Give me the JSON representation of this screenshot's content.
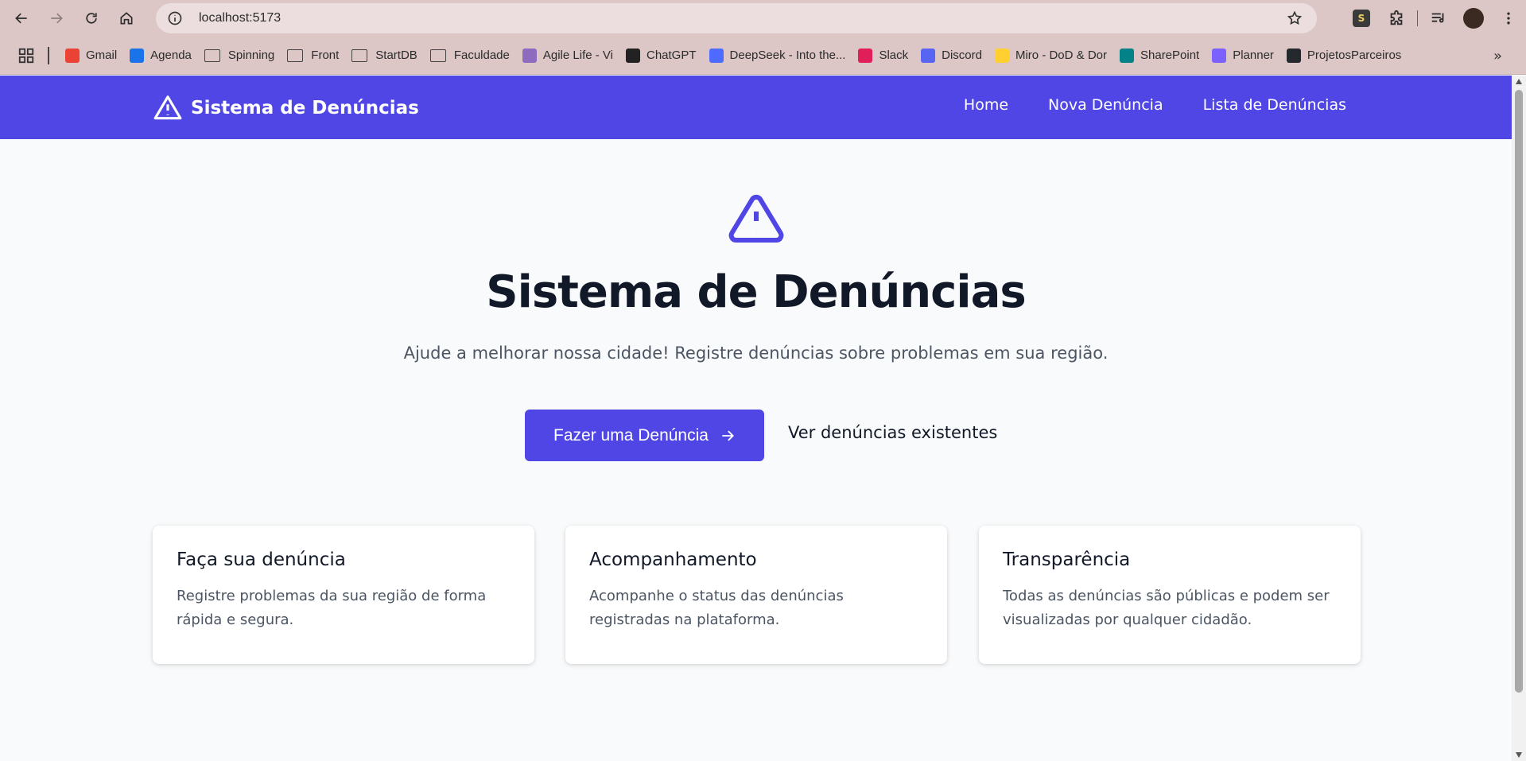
{
  "browser": {
    "url": "localhost:5173",
    "bookmarks": [
      {
        "label": "Gmail",
        "icon": "gmail-icon",
        "color": "#ea4335"
      },
      {
        "label": "Agenda",
        "icon": "calendar-icon",
        "color": "#1a73e8"
      },
      {
        "label": "Spinning",
        "icon": "folder-icon"
      },
      {
        "label": "Front",
        "icon": "folder-icon"
      },
      {
        "label": "StartDB",
        "icon": "folder-icon"
      },
      {
        "label": "Faculdade",
        "icon": "folder-icon"
      },
      {
        "label": "Agile Life - Vi",
        "icon": "avatar-icon",
        "color": "#8e6bbf"
      },
      {
        "label": "ChatGPT",
        "icon": "chatgpt-icon",
        "color": "#222222"
      },
      {
        "label": "DeepSeek - Into the...",
        "icon": "deepseek-icon",
        "color": "#4d6bfe"
      },
      {
        "label": "Slack",
        "icon": "slack-icon",
        "color": "#e01e5a"
      },
      {
        "label": "Discord",
        "icon": "discord-icon",
        "color": "#5865f2"
      },
      {
        "label": "Miro - DoD & Dor",
        "icon": "miro-icon",
        "color": "#ffd02f"
      },
      {
        "label": "SharePoint",
        "icon": "sharepoint-icon",
        "color": "#038387"
      },
      {
        "label": "Planner",
        "icon": "planner-icon",
        "color": "#7b61ff"
      },
      {
        "label": "ProjetosParceiros",
        "icon": "github-icon",
        "color": "#24292e"
      }
    ]
  },
  "navbar": {
    "brand": "Sistema de Denúncias",
    "links": [
      "Home",
      "Nova Denúncia",
      "Lista de Denúncias"
    ],
    "bg_color": "#4f46e5"
  },
  "hero": {
    "title": "Sistema de Denúncias",
    "subtitle": "Ajude a melhorar nossa cidade! Registre denúncias sobre problemas em sua região.",
    "primary_cta": "Fazer uma Denúncia",
    "secondary_cta": "Ver denúncias existentes"
  },
  "cards": [
    {
      "title": "Faça sua denúncia",
      "text": "Registre problemas da sua região de forma rápida e segura."
    },
    {
      "title": "Acompanhamento",
      "text": "Acompanhe o status das denúncias registradas na plataforma."
    },
    {
      "title": "Transparência",
      "text": "Todas as denúncias são públicas e podem ser visualizadas por qualquer cidadão."
    }
  ]
}
